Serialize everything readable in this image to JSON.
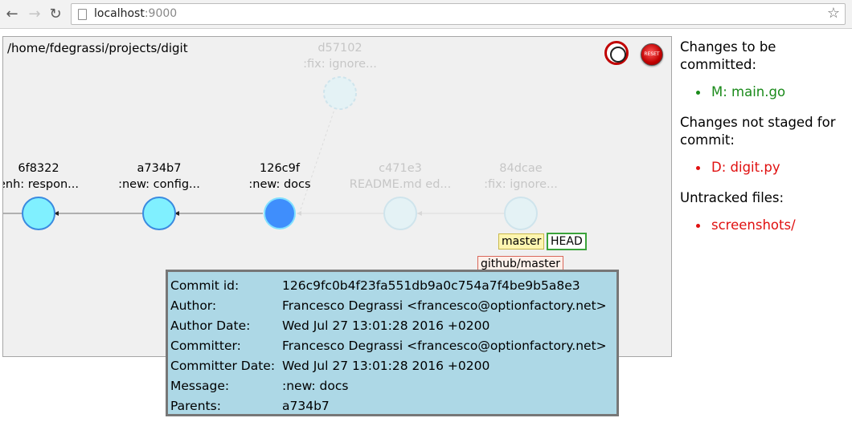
{
  "browser": {
    "url_host": "localhost",
    "url_port": ":9000"
  },
  "graph": {
    "repo_path": "/home/fdegrassi/projects/digit",
    "commits": [
      {
        "hash": "6f8322",
        "message": "enh: respon...",
        "state": "normal",
        "color": "#80f0ff"
      },
      {
        "hash": "a734b7",
        "message": ":new: config...",
        "state": "normal",
        "color": "#80f0ff"
      },
      {
        "hash": "126c9f",
        "message": ":new: docs",
        "state": "selected",
        "color": "#3f8efc"
      },
      {
        "hash": "c471e3",
        "message": "README.md ed...",
        "state": "faded",
        "color": "#e4f2f5"
      },
      {
        "hash": "84dcae",
        "message": ":fix: ignore...",
        "state": "faded",
        "color": "#e4f2f5"
      },
      {
        "hash": "d57102",
        "message": ":fix: ignore...",
        "state": "faded-dashed",
        "color": "#e4f2f5"
      }
    ],
    "refs": {
      "branch": "master",
      "head": "HEAD",
      "remote": "github/master"
    },
    "reset_label": "RESET"
  },
  "tooltip": {
    "rows": [
      {
        "key": "Commit id:",
        "value": "126c9fc0b4f23fa551db9a0c754a7f4be9b5a8e3"
      },
      {
        "key": "Author:",
        "value": "Francesco Degrassi <francesco@optionfactory.net>"
      },
      {
        "key": "Author Date:",
        "value": "Wed Jul 27 13:01:28 2016 +0200"
      },
      {
        "key": "Committer:",
        "value": "Francesco Degrassi <francesco@optionfactory.net>"
      },
      {
        "key": "Committer Date:",
        "value": "Wed Jul 27 13:01:28 2016 +0200"
      },
      {
        "key": "Message:",
        "value": ":new: docs"
      },
      {
        "key": "Parents:",
        "value": "a734b7"
      }
    ]
  },
  "status": {
    "staged_title": "Changes to be committed:",
    "staged": [
      "M: main.go"
    ],
    "unstaged_title": "Changes not staged for commit:",
    "unstaged": [
      "D: digit.py"
    ],
    "untracked_title": "Untracked files:",
    "untracked": [
      "screenshots/"
    ],
    "colors": {
      "staged": "#1a8a1a",
      "unstaged": "#e01010"
    }
  }
}
